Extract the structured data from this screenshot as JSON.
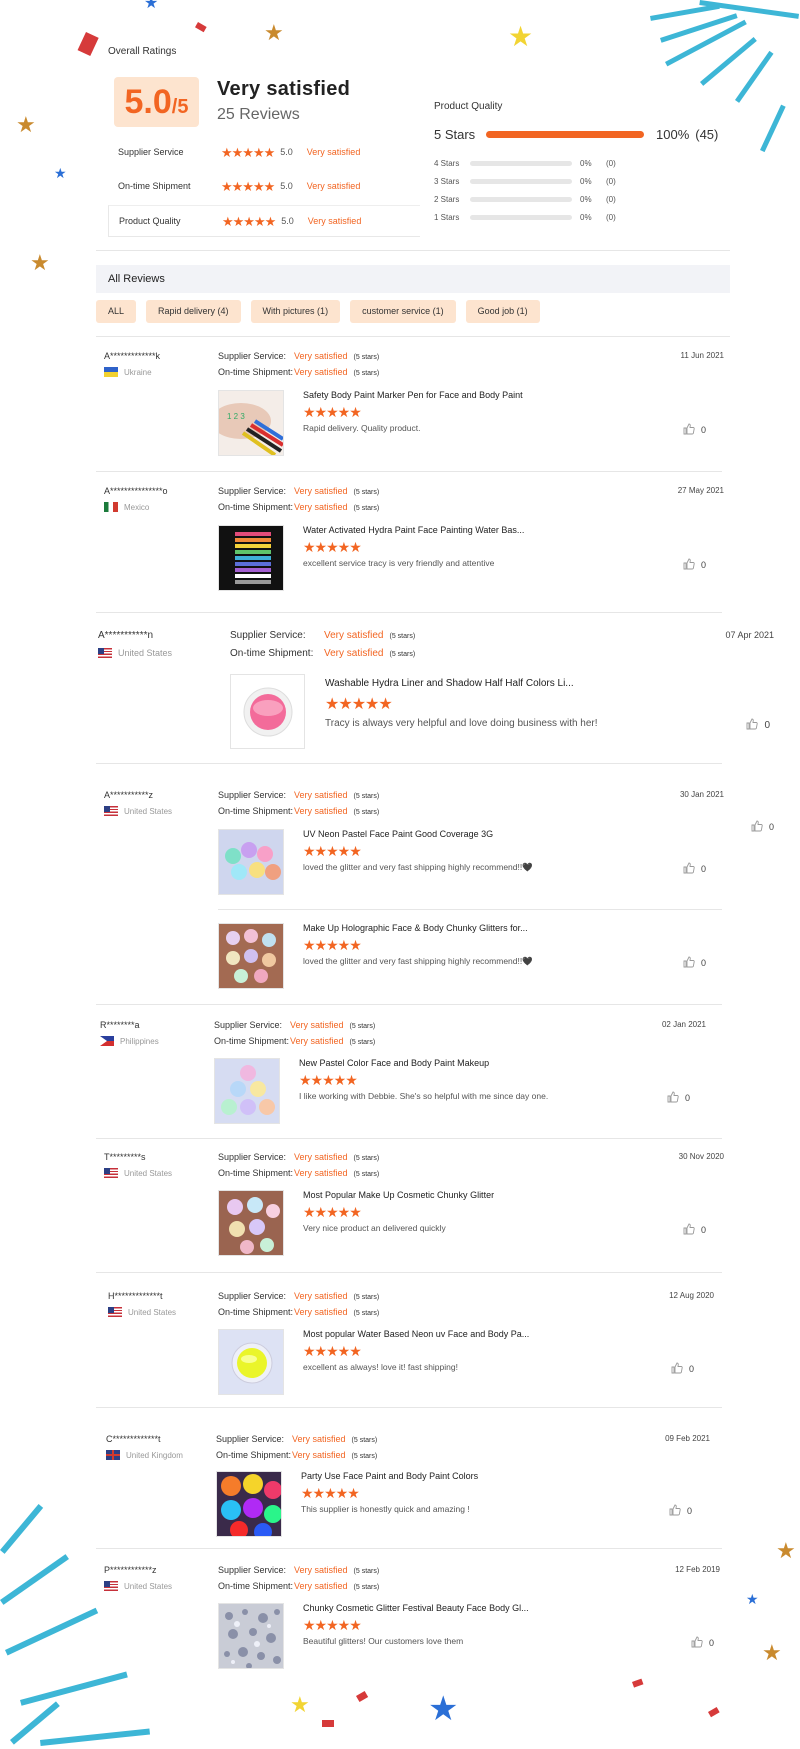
{
  "overall": {
    "title": "Overall Ratings",
    "score": "5.0",
    "score_max": "/5",
    "satisfaction": "Very satisfied",
    "reviews_count": "25 Reviews",
    "sub_ratings": [
      {
        "label": "Supplier Service",
        "stars": "★★★★★",
        "value": "5.0",
        "text": "Very satisfied"
      },
      {
        "label": "On-time Shipment",
        "stars": "★★★★★",
        "value": "5.0",
        "text": "Very satisfied"
      },
      {
        "label": "Product Quality",
        "stars": "★★★★★",
        "value": "5.0",
        "text": "Very satisfied"
      }
    ]
  },
  "product_quality": {
    "title": "Product Quality",
    "five": {
      "label": "5 Stars",
      "percent": "100%",
      "count": "(45)",
      "fill_fraction": 1.0
    },
    "rows": [
      {
        "label": "4 Stars",
        "percent": "0%",
        "count": "(0)"
      },
      {
        "label": "3 Stars",
        "percent": "0%",
        "count": "(0)"
      },
      {
        "label": "2 Stars",
        "percent": "0%",
        "count": "(0)"
      },
      {
        "label": "1 Stars",
        "percent": "0%",
        "count": "(0)"
      }
    ]
  },
  "all_reviews_label": "All Reviews",
  "filters": [
    "ALL",
    "Rapid delivery (4)",
    "With pictures (1)",
    "customer service (1)",
    "Good job (1)"
  ],
  "meta_labels": {
    "supplier": "Supplier Service:",
    "shipment": "On-time Shipment:",
    "value": "Very satisfied",
    "stars": "(5 stars)"
  },
  "reviews": [
    {
      "user": "A*************k",
      "country": "Ukraine",
      "date": "11 Jun 2021",
      "products": [
        {
          "name": "Safety Body Paint Marker Pen for Face and Body Paint",
          "stars": "★★★★★",
          "text": "Rapid delivery. Quality product.",
          "likes": "0"
        }
      ]
    },
    {
      "user": "A***************o",
      "country": "Mexico",
      "date": "27 May 2021",
      "products": [
        {
          "name": "Water Activated Hydra Paint Face Painting Water Bas...",
          "stars": "★★★★★",
          "text": "excellent service tracy is very friendly and attentive",
          "likes": "0"
        }
      ]
    },
    {
      "user": "A***********n",
      "country": "United States",
      "date": "07 Apr 2021",
      "products": [
        {
          "name": "Washable Hydra Liner and Shadow Half Half Colors Li...",
          "stars": "★★★★★",
          "text": "Tracy is always very helpful and love doing business with her!",
          "likes": "0"
        }
      ]
    },
    {
      "user": "A***********z",
      "country": "United States",
      "date": "30 Jan 2021",
      "extra_likes": "0",
      "products": [
        {
          "name": "UV Neon Pastel Face Paint Good Coverage 3G",
          "stars": "★★★★★",
          "text": "loved the glitter and very fast shipping highly recommend!!🖤",
          "likes": "0"
        },
        {
          "name": "Make Up Holographic Face & Body Chunky Glitters for...",
          "stars": "★★★★★",
          "text": "loved the glitter and very fast shipping highly recommend!!🖤",
          "likes": "0"
        }
      ]
    },
    {
      "user": "R********a",
      "country": "Philippines",
      "date": "02 Jan 2021",
      "products": [
        {
          "name": "New Pastel Color Face and Body Paint Makeup",
          "stars": "★★★★★",
          "text": "I like working with Debbie. She's so helpful with me since day one.",
          "likes": "0"
        }
      ]
    },
    {
      "user": "T*********s",
      "country": "United States",
      "date": "30 Nov 2020",
      "products": [
        {
          "name": "Most Popular Make Up Cosmetic Chunky Glitter",
          "stars": "★★★★★",
          "text": "Very nice product an delivered quickly",
          "likes": "0"
        }
      ]
    },
    {
      "user": "H*************t",
      "country": "United States",
      "date": "12 Aug 2020",
      "products": [
        {
          "name": "Most popular Water Based Neon uv Face and Body Pa...",
          "stars": "★★★★★",
          "text": "excellent as always! love it! fast shipping!",
          "likes": "0"
        }
      ]
    },
    {
      "user": "C*************t",
      "country": "United Kingdom",
      "date": "09 Feb 2021",
      "products": [
        {
          "name": "Party Use Face Paint and Body Paint Colors",
          "stars": "★★★★★",
          "text": "This supplier is honestly quick and amazing !",
          "likes": "0"
        }
      ]
    },
    {
      "user": "P************z",
      "country": "United States",
      "date": "12 Feb 2019",
      "products": [
        {
          "name": "Chunky Cosmetic Glitter Festival Beauty Face Body Gl...",
          "stars": "★★★★★",
          "text": "Beautiful glitters! Our customers love them",
          "likes": "0"
        }
      ]
    }
  ],
  "colors": {
    "accent": "#f26522",
    "chip_bg": "#fde4cf",
    "firework": "#3db6d6"
  }
}
